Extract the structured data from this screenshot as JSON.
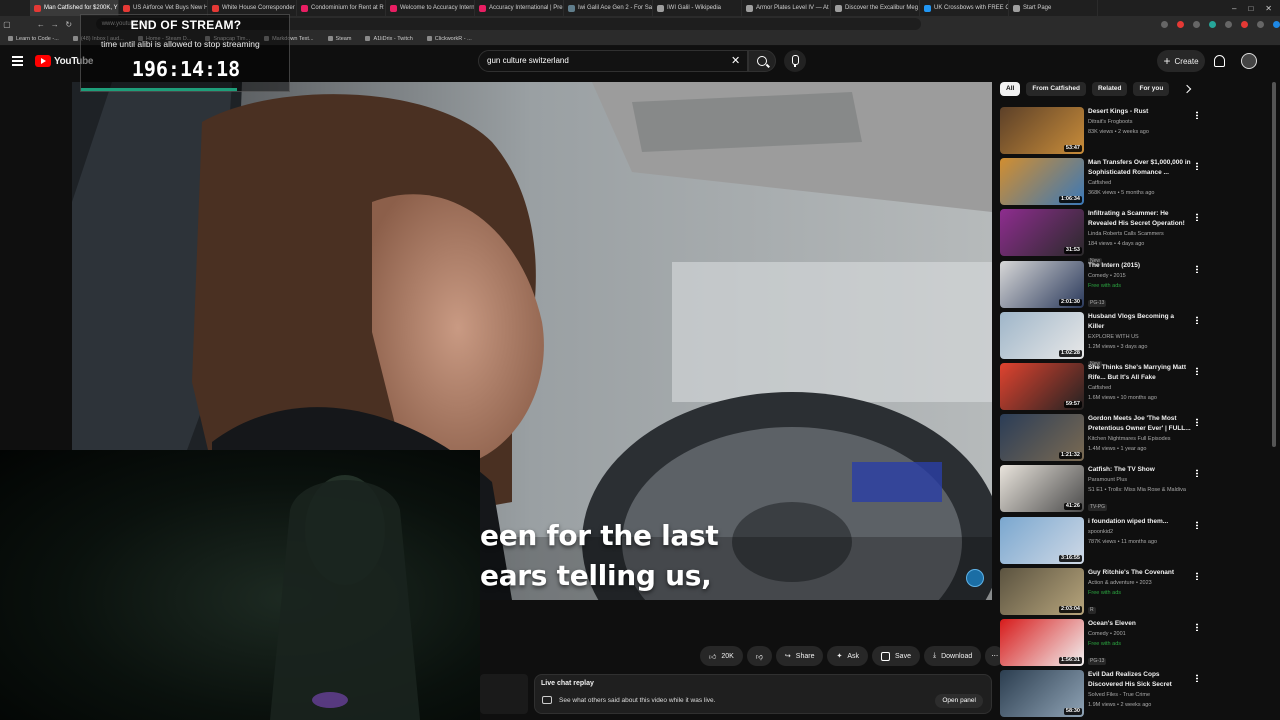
{
  "browser": {
    "tabs": [
      {
        "label": "Man Catfished for $200K, Y",
        "color": "#e53935"
      },
      {
        "label": "US Airforce Vet Buys New H",
        "color": "#e53935"
      },
      {
        "label": "White House Corresponder",
        "color": "#e53935"
      },
      {
        "label": "Condominium for Rent at R",
        "color": "#e91e63"
      },
      {
        "label": "Welcome to Accuracy Intern",
        "color": "#e91e63"
      },
      {
        "label": "Accuracy International | Pre",
        "color": "#e91e63"
      },
      {
        "label": "Iwi Galil Ace Gen 2 - For Sa",
        "color": "#607d8b"
      },
      {
        "label": "IWI Galil - Wikipedia",
        "color": "#9e9e9e"
      },
      {
        "label": "Armor Plates Level IV — At",
        "color": "#9e9e9e"
      },
      {
        "label": "Discover the Excalibur Meg",
        "color": "#9e9e9e"
      },
      {
        "label": "UK Crossbows with FREE Co",
        "color": "#2196f3"
      },
      {
        "label": "Start Page",
        "color": "#9e9e9e"
      }
    ],
    "url": "www.youtube.com",
    "bookmarks": [
      "Learn to Code -...",
      "(48) Inbox | aud...",
      "Home - Steam D...",
      "Snapcap Tim...",
      "Markdown Text...",
      "Steam",
      "A1liDrix - Twitch",
      "ClickworkR - ..."
    ]
  },
  "stream_overlay": {
    "heading": "END OF STREAM?",
    "subheading": "time until alibi is allowed to stop streaming",
    "timer": "196:14:18",
    "progress": 0.75
  },
  "header": {
    "logo_text": "YouTube",
    "search_value": "gun culture switzerland",
    "create_label": "Create"
  },
  "video": {
    "caption_line1": "een for the last",
    "caption_line2": "ears telling us,"
  },
  "actions": {
    "like_count": "20K",
    "share": "Share",
    "ask": "Ask",
    "save": "Save",
    "download": "Download"
  },
  "live_chat": {
    "title": "Live chat replay",
    "description": "See what others said about this video while it was live.",
    "button": "Open panel"
  },
  "filters": [
    "All",
    "From Catfished",
    "Related",
    "For you"
  ],
  "recommendations": [
    {
      "title": "Desert Kings - Rust",
      "channel": "Ditrait's Frogboots",
      "meta": "83K views • 2 weeks ago",
      "duration": "53:47",
      "thumb": [
        "#5c4028",
        "#c98d3a"
      ]
    },
    {
      "title": "Man Transfers Over $1,000,000 in Sophisticated Romance ...",
      "channel": "Catfished",
      "meta": "368K views • 5 months ago",
      "duration": "1:06:34",
      "thumb": [
        "#d28e2f",
        "#3a78b8"
      ]
    },
    {
      "title": "Infiltrating a Scammer: He Revealed His Secret Operation!",
      "channel": "Linda Roberts Calls Scammers",
      "meta": "184 views • 4 days ago",
      "tag": "New",
      "duration": "31:53",
      "thumb": [
        "#8e2d8f",
        "#2a2a2a"
      ]
    },
    {
      "title": "The Intern (2015)",
      "channel": "Comedy • 2015",
      "meta": "Free with ads",
      "tag": "PG-13",
      "duration": "2:01:30",
      "thumb": [
        "#d7d7d7",
        "#2b3a5c"
      ]
    },
    {
      "title": "Husband Vlogs Becoming a Killer",
      "channel": "EXPLORE WITH US",
      "meta": "1.2M views • 3 days ago",
      "tag": "New",
      "duration": "1:02:28",
      "thumb": [
        "#9fb6c9",
        "#e8e8e8"
      ]
    },
    {
      "title": "She Thinks She's Marrying Matt Rife... But It's All Fake",
      "channel": "Catfished",
      "meta": "1.6M views • 10 months ago",
      "duration": "59:57",
      "thumb": [
        "#e0432f",
        "#222222"
      ]
    },
    {
      "title": "Gordon Meets Joe 'The Most Pretentious Owner Ever' | FULL...",
      "channel": "Kitchen Nightmares Full Episodes",
      "meta": "1.4M views • 1 year ago",
      "duration": "1:21:32",
      "thumb": [
        "#2b3d57",
        "#7a6a52"
      ]
    },
    {
      "title": "Catfish: The TV Show",
      "channel": "Paramount Plus",
      "meta": "S1 E1 • Trolls: Miss Mia Rose & Maldiva",
      "tag": "TV-PG",
      "duration": "41:26",
      "thumb": [
        "#e9e4dc",
        "#4b4b4b"
      ]
    },
    {
      "title": "i foundation wiped them...",
      "channel": "spoonkid2",
      "meta": "787K views • 11 months ago",
      "duration": "3:16:55",
      "thumb": [
        "#7aa7cf",
        "#cfd9e6"
      ]
    },
    {
      "title": "Guy Ritchie's The Covenant",
      "channel": "Action & adventure • 2023",
      "meta": "Free with ads",
      "tag": "R",
      "duration": "2:03:04",
      "thumb": [
        "#5b5340",
        "#b7a57c"
      ]
    },
    {
      "title": "Ocean's Eleven",
      "channel": "Comedy • 2001",
      "meta": "Free with ads",
      "tag": "PG-13",
      "duration": "1:56:31",
      "thumb": [
        "#d71b1b",
        "#f2f2f2"
      ]
    },
    {
      "title": "Evil Dad Realizes Cops Discovered His Sick Secret",
      "channel": "Solved Files - True Crime",
      "meta": "1.9M views • 2 weeks ago",
      "duration": "58:30",
      "thumb": [
        "#2c3e50",
        "#8fa3b5"
      ]
    }
  ]
}
